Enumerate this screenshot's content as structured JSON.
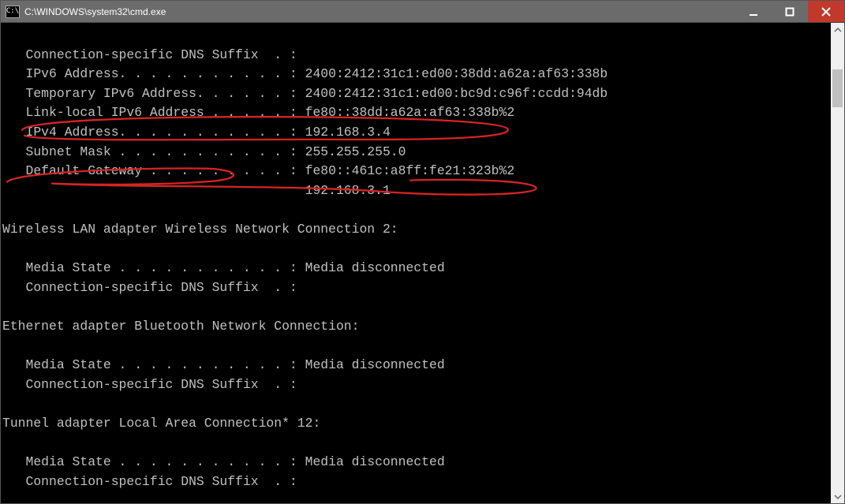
{
  "window": {
    "title": "C:\\WINDOWS\\system32\\cmd.exe",
    "icon_label": "C:\\"
  },
  "adapters": [
    {
      "name": null,
      "indent": "   ",
      "props": [
        {
          "label": "Connection-specific DNS Suffix  . :",
          "value": ""
        },
        {
          "label": "IPv6 Address. . . . . . . . . . . :",
          "value": "2400:2412:31c1:ed00:38dd:a62a:af63:338b"
        },
        {
          "label": "Temporary IPv6 Address. . . . . . :",
          "value": "2400:2412:31c1:ed00:bc9d:c96f:ccdd:94db"
        },
        {
          "label": "Link-local IPv6 Address . . . . . :",
          "value": "fe80::38dd:a62a:af63:338b%2"
        },
        {
          "label": "IPv4 Address. . . . . . . . . . . :",
          "value": "192.168.3.4"
        },
        {
          "label": "Subnet Mask . . . . . . . . . . . :",
          "value": "255.255.255.0"
        },
        {
          "label": "Default Gateway . . . . . . . . . :",
          "value": "fe80::461c:a8ff:fe21:323b%2"
        },
        {
          "label": "                                   ",
          "value": "192.168.3.1"
        }
      ]
    },
    {
      "name": "Wireless LAN adapter Wireless Network Connection 2:",
      "indent": "   ",
      "props": [
        {
          "label": "Media State . . . . . . . . . . . :",
          "value": "Media disconnected"
        },
        {
          "label": "Connection-specific DNS Suffix  . :",
          "value": ""
        }
      ]
    },
    {
      "name": "Ethernet adapter Bluetooth Network Connection:",
      "indent": "   ",
      "props": [
        {
          "label": "Media State . . . . . . . . . . . :",
          "value": "Media disconnected"
        },
        {
          "label": "Connection-specific DNS Suffix  . :",
          "value": ""
        }
      ]
    },
    {
      "name": "Tunnel adapter Local Area Connection* 12:",
      "indent": "   ",
      "props": [
        {
          "label": "Media State . . . . . . . . . . . :",
          "value": "Media disconnected"
        },
        {
          "label": "Connection-specific DNS Suffix  . :",
          "value": ""
        }
      ]
    }
  ],
  "colors": {
    "titlebar_bg": "#6b6b6b",
    "close_bg": "#c0392b",
    "console_bg": "#000000",
    "console_fg": "#c0c0c0",
    "annotation": "#d62424"
  }
}
